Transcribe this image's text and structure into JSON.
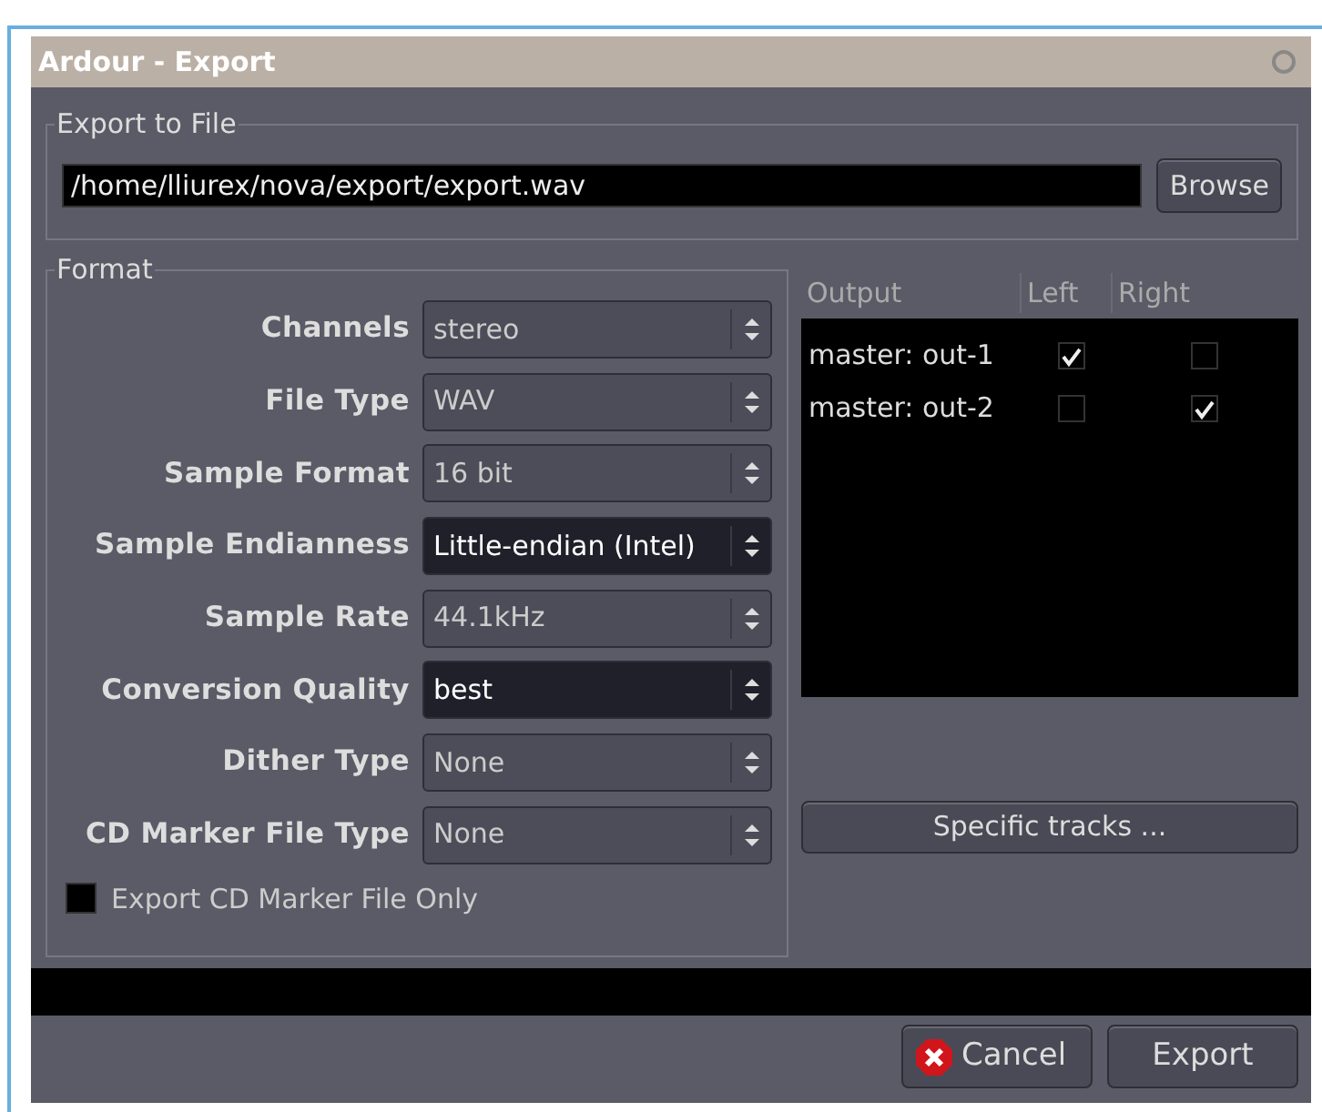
{
  "window": {
    "title": "Ardour - Export"
  },
  "export_to_file": {
    "label": "Export to File",
    "path": "/home/lliurex/nova/export/export.wav",
    "browse_button": "Browse"
  },
  "format": {
    "label": "Format",
    "fields": [
      {
        "label": "Channels",
        "value": "stereo",
        "highlighted": false
      },
      {
        "label": "File Type",
        "value": "WAV",
        "highlighted": false
      },
      {
        "label": "Sample Format",
        "value": "16 bit",
        "highlighted": false
      },
      {
        "label": "Sample Endianness",
        "value": "Little-endian (Intel)",
        "highlighted": true
      },
      {
        "label": "Sample Rate",
        "value": "44.1kHz",
        "highlighted": false
      },
      {
        "label": "Conversion Quality",
        "value": "best",
        "highlighted": true
      },
      {
        "label": "Dither Type",
        "value": "None",
        "highlighted": false
      },
      {
        "label": "CD Marker File Type",
        "value": "None",
        "highlighted": false
      }
    ],
    "cd_marker_only": {
      "label": "Export CD Marker File Only",
      "checked": false
    }
  },
  "outputs": {
    "columns": [
      "Output",
      "Left",
      "Right"
    ],
    "rows": [
      {
        "name": "master: out-1",
        "left": true,
        "right": false
      },
      {
        "name": "master: out-2",
        "left": false,
        "right": true
      }
    ],
    "specific_tracks_button": "Specific tracks ..."
  },
  "buttons": {
    "cancel": "Cancel",
    "export": "Export"
  }
}
